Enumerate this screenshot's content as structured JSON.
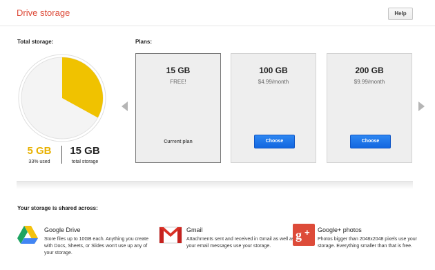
{
  "header": {
    "title": "Drive storage",
    "help_label": "Help"
  },
  "total": {
    "label": "Total storage:",
    "used_value": "5 GB",
    "used_caption": "33% used",
    "used_fraction": 0.33,
    "total_value": "15 GB",
    "total_caption": "total storage"
  },
  "plans": {
    "label": "Plans:",
    "items": [
      {
        "size": "15 GB",
        "price": "FREE!",
        "status": "Current plan"
      },
      {
        "size": "100 GB",
        "price": "$4.99/month",
        "button": "Choose"
      },
      {
        "size": "200 GB",
        "price": "$9.99/month",
        "button": "Choose"
      }
    ]
  },
  "shared": {
    "label": "Your storage is shared across:",
    "items": [
      {
        "name": "Google Drive",
        "description": "Store files up to 10GB each. Anything you create with Docs, Sheets, or Slides won't use up any of your storage.",
        "icon": "google-drive-icon"
      },
      {
        "name": "Gmail",
        "description": "Attachments sent and received in Gmail as well as your email messages use your storage.",
        "icon": "gmail-icon"
      },
      {
        "name": "Google+ photos",
        "description": "Photos bigger than 2048x2048 pixels use your storage. Everything smaller than that is free.",
        "icon": "google-plus-icon"
      }
    ]
  },
  "colors": {
    "accent_red": "#dd4b39",
    "used_yellow": "#f0c200",
    "button_blue": "#1a73e8"
  }
}
